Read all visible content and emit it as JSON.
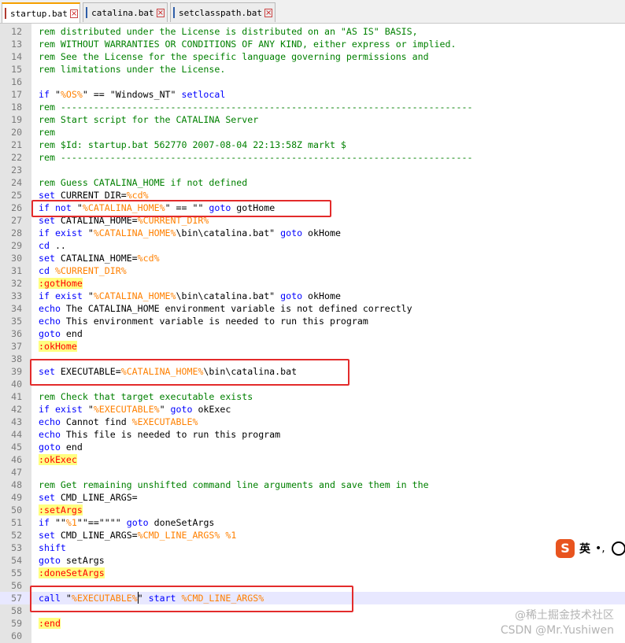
{
  "tabs": [
    {
      "label": "startup.bat",
      "active": true,
      "icon": "red-file-icon"
    },
    {
      "label": "catalina.bat",
      "active": false,
      "icon": "blue-file-icon"
    },
    {
      "label": "setclasspath.bat",
      "active": false,
      "icon": "blue-file-icon"
    }
  ],
  "colors": {
    "keyword": "#0000ff",
    "comment": "#008000",
    "variable": "#ff8000",
    "label_text": "#ff0000",
    "label_background": "#ffff80",
    "annotation_box": "#e32b2b"
  },
  "editor": {
    "current_line": 57,
    "highlighted_lines": [
      26,
      39,
      57
    ],
    "lines": [
      {
        "n": "12",
        "segs": [
          [
            "cm",
            "rem distributed under the License is distributed on an \"AS IS\" BASIS,"
          ]
        ]
      },
      {
        "n": "13",
        "segs": [
          [
            "cm",
            "rem WITHOUT WARRANTIES OR CONDITIONS OF ANY KIND, either express or implied."
          ]
        ]
      },
      {
        "n": "14",
        "segs": [
          [
            "cm",
            "rem See the License for the specific language governing permissions and"
          ]
        ]
      },
      {
        "n": "15",
        "segs": [
          [
            "cm",
            "rem limitations under the License."
          ]
        ]
      },
      {
        "n": "16",
        "segs": []
      },
      {
        "n": "17",
        "segs": [
          [
            "kw",
            "if"
          ],
          [
            "",
            " \""
          ],
          [
            "var",
            "%OS%"
          ],
          [
            "",
            "\" == \"Windows_NT\" "
          ],
          [
            "kw",
            "setlocal"
          ]
        ]
      },
      {
        "n": "18",
        "segs": [
          [
            "cm",
            "rem ---------------------------------------------------------------------------"
          ]
        ]
      },
      {
        "n": "19",
        "segs": [
          [
            "cm",
            "rem Start script for the CATALINA Server"
          ]
        ]
      },
      {
        "n": "20",
        "segs": [
          [
            "cm",
            "rem"
          ]
        ]
      },
      {
        "n": "21",
        "segs": [
          [
            "cm",
            "rem $Id: startup.bat 562770 2007-08-04 22:13:58Z markt $"
          ]
        ]
      },
      {
        "n": "22",
        "segs": [
          [
            "cm",
            "rem ---------------------------------------------------------------------------"
          ]
        ]
      },
      {
        "n": "23",
        "segs": []
      },
      {
        "n": "24",
        "segs": [
          [
            "cm",
            "rem Guess CATALINA_HOME if not defined"
          ]
        ]
      },
      {
        "n": "25",
        "segs": [
          [
            "kw",
            "set"
          ],
          [
            "",
            " CURRENT_DIR="
          ],
          [
            "var",
            "%cd%"
          ]
        ]
      },
      {
        "n": "26",
        "segs": [
          [
            "kw",
            "if not"
          ],
          [
            "",
            " \""
          ],
          [
            "var",
            "%CATALINA_HOME%"
          ],
          [
            "",
            "\" == \"\" "
          ],
          [
            "kw",
            "goto"
          ],
          [
            "",
            " gotHome"
          ]
        ]
      },
      {
        "n": "27",
        "segs": [
          [
            "kw",
            "set"
          ],
          [
            "",
            " CATALINA_HOME="
          ],
          [
            "var",
            "%CURRENT_DIR%"
          ]
        ]
      },
      {
        "n": "28",
        "segs": [
          [
            "kw",
            "if exist"
          ],
          [
            "",
            " \""
          ],
          [
            "var",
            "%CATALINA_HOME%"
          ],
          [
            "",
            "\\bin\\catalina.bat\" "
          ],
          [
            "kw",
            "goto"
          ],
          [
            "",
            " okHome"
          ]
        ]
      },
      {
        "n": "29",
        "segs": [
          [
            "kw",
            "cd"
          ],
          [
            "",
            " .."
          ]
        ]
      },
      {
        "n": "30",
        "segs": [
          [
            "kw",
            "set"
          ],
          [
            "",
            " CATALINA_HOME="
          ],
          [
            "var",
            "%cd%"
          ]
        ]
      },
      {
        "n": "31",
        "segs": [
          [
            "kw",
            "cd"
          ],
          [
            "",
            " "
          ],
          [
            "var",
            "%CURRENT_DIR%"
          ]
        ]
      },
      {
        "n": "32",
        "segs": [
          [
            "lbl",
            ":gotHome"
          ]
        ]
      },
      {
        "n": "33",
        "segs": [
          [
            "kw",
            "if exist"
          ],
          [
            "",
            " \""
          ],
          [
            "var",
            "%CATALINA_HOME%"
          ],
          [
            "",
            "\\bin\\catalina.bat\" "
          ],
          [
            "kw",
            "goto"
          ],
          [
            "",
            " okHome"
          ]
        ]
      },
      {
        "n": "34",
        "segs": [
          [
            "kw",
            "echo"
          ],
          [
            "",
            " The CATALINA_HOME environment variable is not defined correctly"
          ]
        ]
      },
      {
        "n": "35",
        "segs": [
          [
            "kw",
            "echo"
          ],
          [
            "",
            " This environment variable is needed to run this program"
          ]
        ]
      },
      {
        "n": "36",
        "segs": [
          [
            "kw",
            "goto"
          ],
          [
            "",
            " end"
          ]
        ]
      },
      {
        "n": "37",
        "segs": [
          [
            "lbl",
            ":okHome"
          ]
        ]
      },
      {
        "n": "38",
        "segs": []
      },
      {
        "n": "39",
        "segs": [
          [
            "kw",
            "set"
          ],
          [
            "",
            " EXECUTABLE="
          ],
          [
            "var",
            "%CATALINA_HOME%"
          ],
          [
            "",
            "\\bin\\catalina.bat"
          ]
        ]
      },
      {
        "n": "40",
        "segs": []
      },
      {
        "n": "41",
        "segs": [
          [
            "cm",
            "rem Check that target executable exists"
          ]
        ]
      },
      {
        "n": "42",
        "segs": [
          [
            "kw",
            "if exist"
          ],
          [
            "",
            " \""
          ],
          [
            "var",
            "%EXECUTABLE%"
          ],
          [
            "",
            "\" "
          ],
          [
            "kw",
            "goto"
          ],
          [
            "",
            " okExec"
          ]
        ]
      },
      {
        "n": "43",
        "segs": [
          [
            "kw",
            "echo"
          ],
          [
            "",
            " Cannot find "
          ],
          [
            "var",
            "%EXECUTABLE%"
          ]
        ]
      },
      {
        "n": "44",
        "segs": [
          [
            "kw",
            "echo"
          ],
          [
            "",
            " This file is needed to run this program"
          ]
        ]
      },
      {
        "n": "45",
        "segs": [
          [
            "kw",
            "goto"
          ],
          [
            "",
            " end"
          ]
        ]
      },
      {
        "n": "46",
        "segs": [
          [
            "lbl",
            ":okExec"
          ]
        ]
      },
      {
        "n": "47",
        "segs": []
      },
      {
        "n": "48",
        "segs": [
          [
            "cm",
            "rem Get remaining unshifted command line arguments and save them in the"
          ]
        ]
      },
      {
        "n": "49",
        "segs": [
          [
            "kw",
            "set"
          ],
          [
            "",
            " CMD_LINE_ARGS="
          ]
        ]
      },
      {
        "n": "50",
        "segs": [
          [
            "lbl",
            ":setArgs"
          ]
        ]
      },
      {
        "n": "51",
        "segs": [
          [
            "kw",
            "if"
          ],
          [
            "",
            " \"\""
          ],
          [
            "var",
            "%1"
          ],
          [
            "",
            "\"\"==\"\"\"\" "
          ],
          [
            "kw",
            "goto"
          ],
          [
            "",
            " doneSetArgs"
          ]
        ]
      },
      {
        "n": "52",
        "segs": [
          [
            "kw",
            "set"
          ],
          [
            "",
            " CMD_LINE_ARGS="
          ],
          [
            "var",
            "%CMD_LINE_ARGS%"
          ],
          [
            "",
            " "
          ],
          [
            "var",
            "%1"
          ]
        ]
      },
      {
        "n": "53",
        "segs": [
          [
            "kw",
            "shift"
          ]
        ]
      },
      {
        "n": "54",
        "segs": [
          [
            "kw",
            "goto"
          ],
          [
            "",
            " setArgs"
          ]
        ]
      },
      {
        "n": "55",
        "segs": [
          [
            "lbl",
            ":doneSetArgs"
          ]
        ]
      },
      {
        "n": "56",
        "segs": []
      },
      {
        "n": "57",
        "segs": [
          [
            "kw",
            "call"
          ],
          [
            "",
            " \""
          ],
          [
            "var",
            "%EXECUTABLE%"
          ],
          [
            "",
            "\" "
          ],
          [
            "kw",
            "start"
          ],
          [
            "",
            " "
          ],
          [
            "var",
            "%CMD_LINE_ARGS%"
          ]
        ]
      },
      {
        "n": "58",
        "segs": []
      },
      {
        "n": "59",
        "segs": [
          [
            "lbl",
            ":end"
          ]
        ]
      },
      {
        "n": "60",
        "segs": []
      }
    ]
  },
  "ime": {
    "logo": "S",
    "mode": "英",
    "punct": "•,",
    "emoji_icon": "smiley-icon"
  },
  "watermark": {
    "line1": "@稀土掘金技术社区",
    "line2": "CSDN @Mr.Yushiwen"
  }
}
